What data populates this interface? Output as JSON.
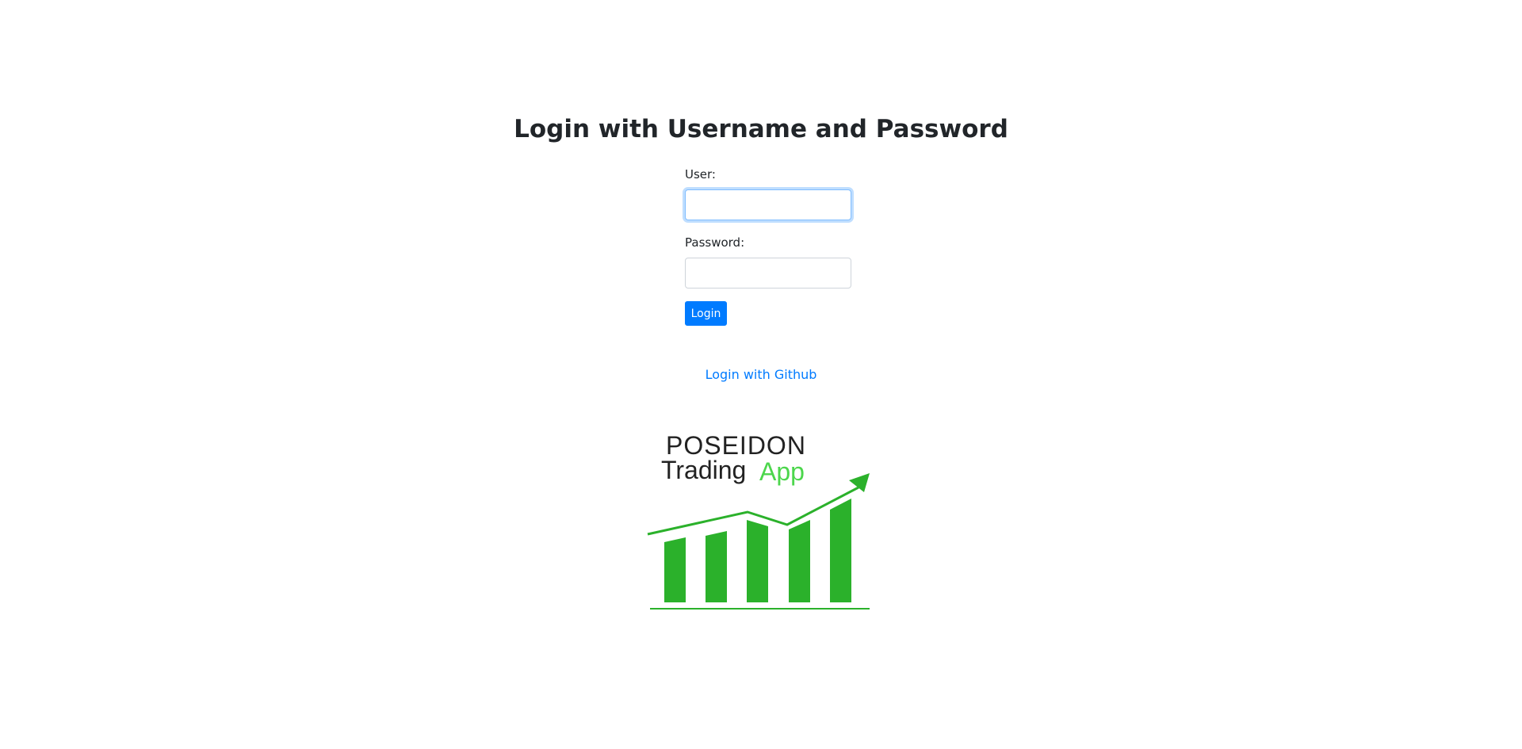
{
  "heading": "Login with Username and Password",
  "form": {
    "user_label": "User:",
    "user_value": "",
    "password_label": "Password:",
    "password_value": "",
    "login_button": "Login"
  },
  "github_link": "Login with Github",
  "logo": {
    "line1": "POSEIDON",
    "line2_a": "Trading",
    "line2_b": "App",
    "text_color": "#222222",
    "accent_color": "#2bb12b",
    "app_color": "#4cd64c"
  },
  "colors": {
    "primary": "#007bff",
    "text": "#212529"
  }
}
